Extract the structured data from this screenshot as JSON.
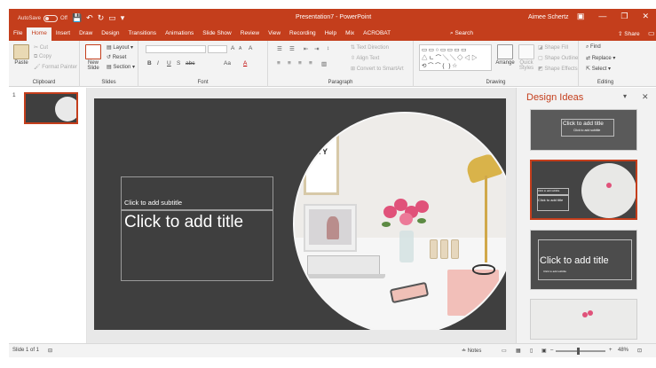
{
  "window": {
    "autosave_label": "AutoSave",
    "autosave_state": "Off",
    "doc_title": "Presentation7 - PowerPoint",
    "user_name": "Aimee Schertz",
    "minimize_glyph": "—",
    "restore_glyph": "❐",
    "close_glyph": "✕",
    "ribbon_display_glyph": "▣",
    "qat": {
      "save_glyph": "💾",
      "undo_glyph": "↶",
      "redo_glyph": "↻",
      "present_glyph": "▭",
      "customize_glyph": "▾"
    }
  },
  "tabs": [
    "File",
    "Home",
    "Insert",
    "Draw",
    "Design",
    "Transitions",
    "Animations",
    "Slide Show",
    "Review",
    "View",
    "Recording",
    "Help",
    "Mix",
    "ACROBAT"
  ],
  "active_tab": "Home",
  "tell_me": "Search",
  "share_label": "Share",
  "ribbon": {
    "clipboard": {
      "group": "Clipboard",
      "paste": "Paste",
      "cut": "Cut",
      "copy": "Copy",
      "format_painter": "Format Painter"
    },
    "slides": {
      "group": "Slides",
      "new_slide": "New Slide",
      "layout": "Layout",
      "reset": "Reset",
      "section": "Section"
    },
    "font": {
      "group": "Font",
      "bold": "B",
      "italic": "I",
      "underline": "U",
      "shadow": "S",
      "strike": "abc",
      "grow": "A",
      "shrink": "A",
      "clear": "A",
      "case": "Aa",
      "color": "A"
    },
    "paragraph": {
      "group": "Paragraph",
      "text_direction": "Text Direction",
      "align_text": "Align Text",
      "smartart": "Convert to SmartArt"
    },
    "drawing": {
      "group": "Drawing",
      "shapes_row1": "▭▭○▭▭▭▭",
      "shapes_row2": "△ㄴ⌒╲╲◇◁▷",
      "shapes_row3": "⟲⌒⌒{ }☆",
      "arrange": "Arrange",
      "quick_styles": "Quick Styles",
      "shape_fill": "Shape Fill",
      "shape_outline": "Shape Outline",
      "shape_effects": "Shape Effects"
    },
    "editing": {
      "group": "Editing",
      "find": "Find",
      "replace": "Replace",
      "select": "Select"
    }
  },
  "thumbnails": {
    "number": "1"
  },
  "slide": {
    "subtitle_placeholder": "Click to add subtitle",
    "title_placeholder": "Click to add title",
    "frame_text": "ITY"
  },
  "design_ideas": {
    "title": "Design Ideas",
    "ideas": [
      {
        "title": "Click to add title",
        "subtitle": "Click to add subtitle"
      },
      {
        "title": "Click to add title",
        "subtitle": "Click to add subtitle"
      },
      {
        "title": "Click to add title",
        "subtitle": "Click to add subtitle"
      },
      {
        "title": "",
        "subtitle": ""
      }
    ]
  },
  "status": {
    "slide_info": "Slide 1 of 1",
    "notes": "Notes",
    "zoom": "48%",
    "zoom_minus": "–",
    "zoom_plus": "+",
    "fit_glyph": "⊡"
  },
  "colors": {
    "accent": "#c43e1c",
    "slide_bg": "#3f3f3f",
    "pane_bg": "#f2f2f2"
  }
}
